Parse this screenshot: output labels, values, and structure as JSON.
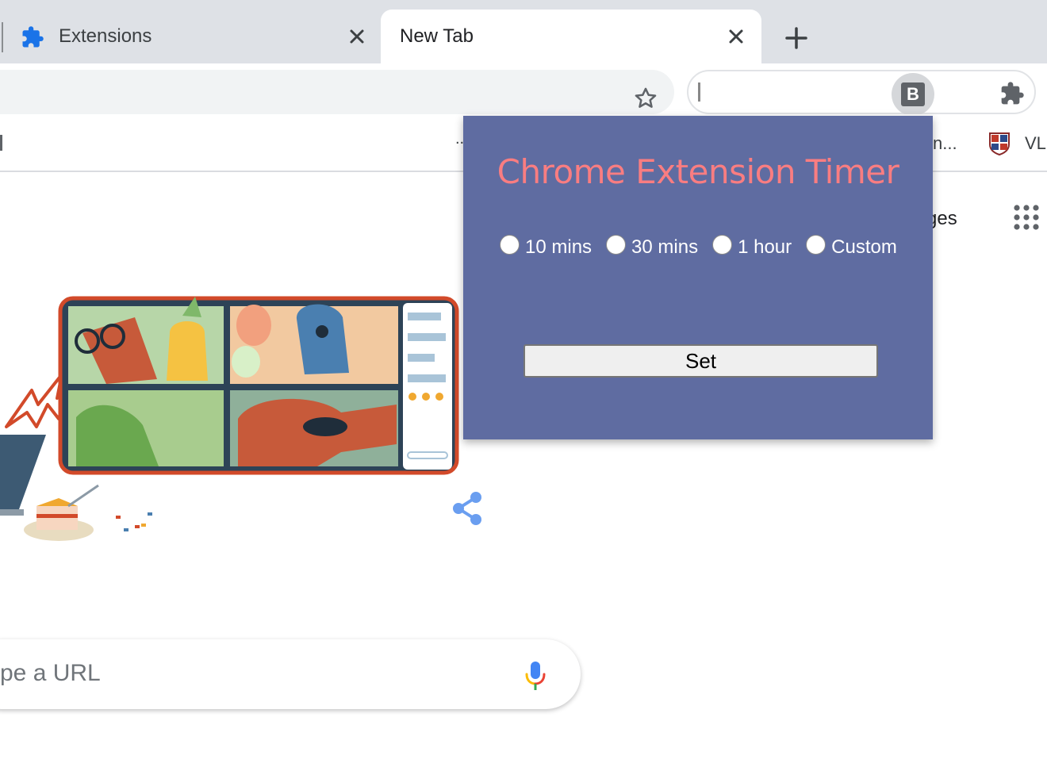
{
  "tabs": [
    {
      "label": "Extensions",
      "icon": "puzzle-icon"
    },
    {
      "label": "New Tab",
      "icon": null
    }
  ],
  "toolbar": {
    "bookmark_icon": "star-icon",
    "extension_b_label": "B",
    "extensions_icon": "puzzle-icon"
  },
  "bookmarks": {
    "items": [
      {
        "label": ".."
      },
      {
        "label": "n..."
      },
      {
        "label": "VL"
      }
    ]
  },
  "page": {
    "images_link": "ges",
    "search_placeholder": "pe a URL"
  },
  "popup": {
    "title": "Chrome Extension Timer",
    "options": [
      "10 mins",
      "30 mins",
      "1 hour",
      "Custom"
    ],
    "set_label": "Set",
    "colors": {
      "background": "#5f6ca1",
      "title": "#f97d81"
    }
  }
}
